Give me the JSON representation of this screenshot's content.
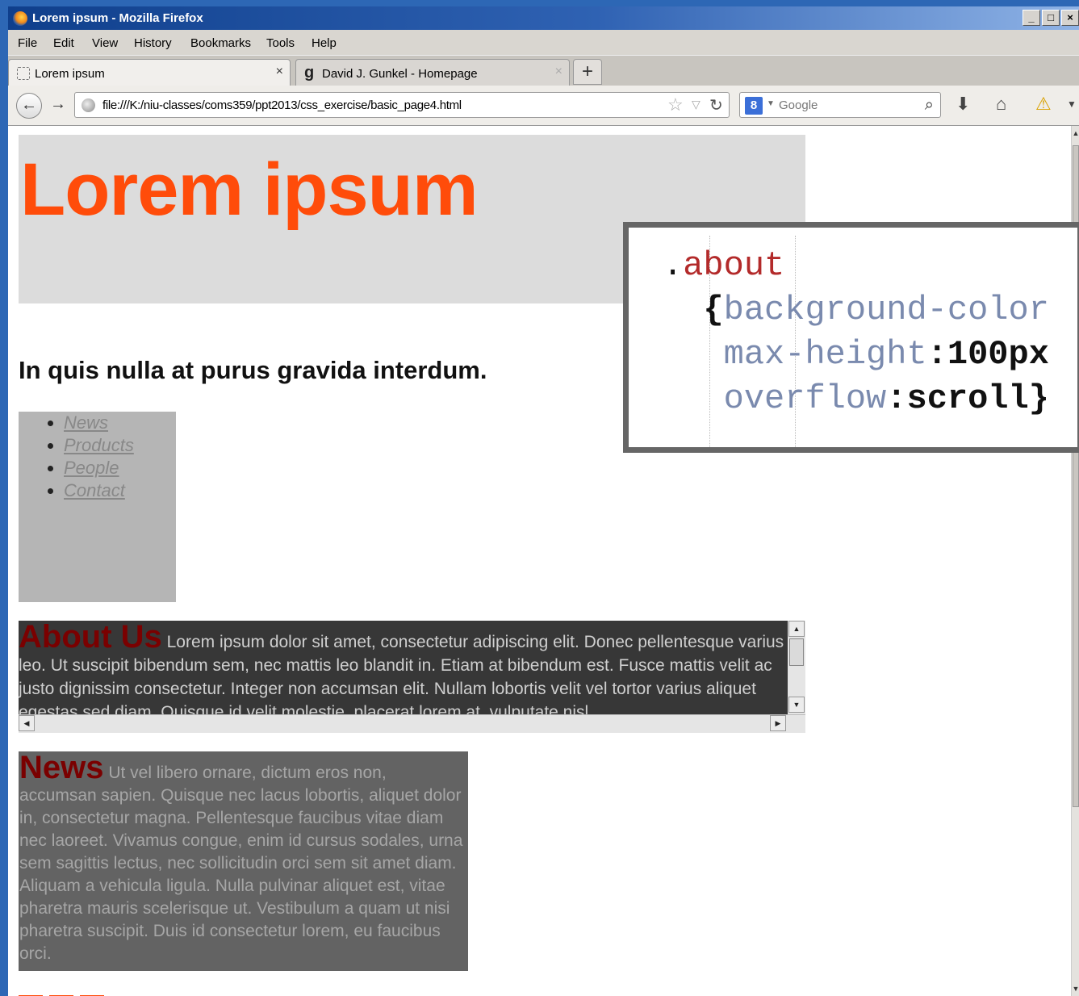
{
  "window": {
    "title": "Lorem ipsum - Mozilla Firefox",
    "controls": [
      "_",
      "□",
      "×"
    ]
  },
  "menu": {
    "items": [
      "File",
      "Edit",
      "View",
      "History",
      "Bookmarks",
      "Tools",
      "Help"
    ]
  },
  "tabs": [
    {
      "label": "Lorem ipsum",
      "close": "×",
      "active": true
    },
    {
      "label": "David J. Gunkel - Homepage",
      "close": "×",
      "active": false
    }
  ],
  "new_tab_label": "+",
  "navigation": {
    "url": "file:///K:/niu-classes/coms359/ppt2013/css_exercise/basic_page4.html",
    "search_placeholder": "Google",
    "search_engine_glyph": "8"
  },
  "page": {
    "header_title": "Lorem ipsum",
    "subheading": "In quis nulla at purus gravida interdum.",
    "nav_links": [
      "News",
      "Products",
      "People",
      "Contact"
    ],
    "about": {
      "heading": "About Us",
      "text": "Lorem ipsum dolor sit amet, consectetur adipiscing elit. Donec pellentesque varius leo. Ut suscipit bibendum sem, nec mattis leo blandit in. Etiam at bibendum est. Fusce mattis velit ac justo dignissim consectetur. Integer non accumsan elit. Nullam lobortis velit vel tortor varius aliquet egestas sed diam. Quisque id velit molestie, placerat lorem at, vulputate nisl."
    },
    "news": {
      "heading": "News",
      "text": "Ut vel libero ornare, dictum eros non, accumsan sapien. Quisque nec lacus lobortis, aliquet dolor in, consectetur magna. Pellentesque faucibus vitae diam nec laoreet. Vivamus congue, enim id cursus sodales, urna sem sagittis lectus, nec sollicitudin orci sem sit amet diam. Aliquam a vehicula ligula. Nulla pulvinar aliquet est, vitae pharetra mauris scelerisque ut. Vestibulum a quam ut nisi pharetra suscipit. Duis id consectetur lorem, eu faucibus orci."
    }
  },
  "code_overlay": {
    "dot": ".",
    "selector": "about",
    "brace_open": "{",
    "prop1": "background-color",
    "prop2": "max-height",
    "colon": ":",
    "value2": "100px",
    "prop3": "overflow",
    "value3": "scroll}"
  },
  "colors": {
    "header_title": "#ff4c0a",
    "section_heading": "#7a0000",
    "header_bg": "#dcdcdc",
    "about_bg": "#373737",
    "news_bg": "#636363",
    "nav_bg": "#b5b5b5",
    "selector": "#b32a2a",
    "property": "#7a8aae"
  }
}
